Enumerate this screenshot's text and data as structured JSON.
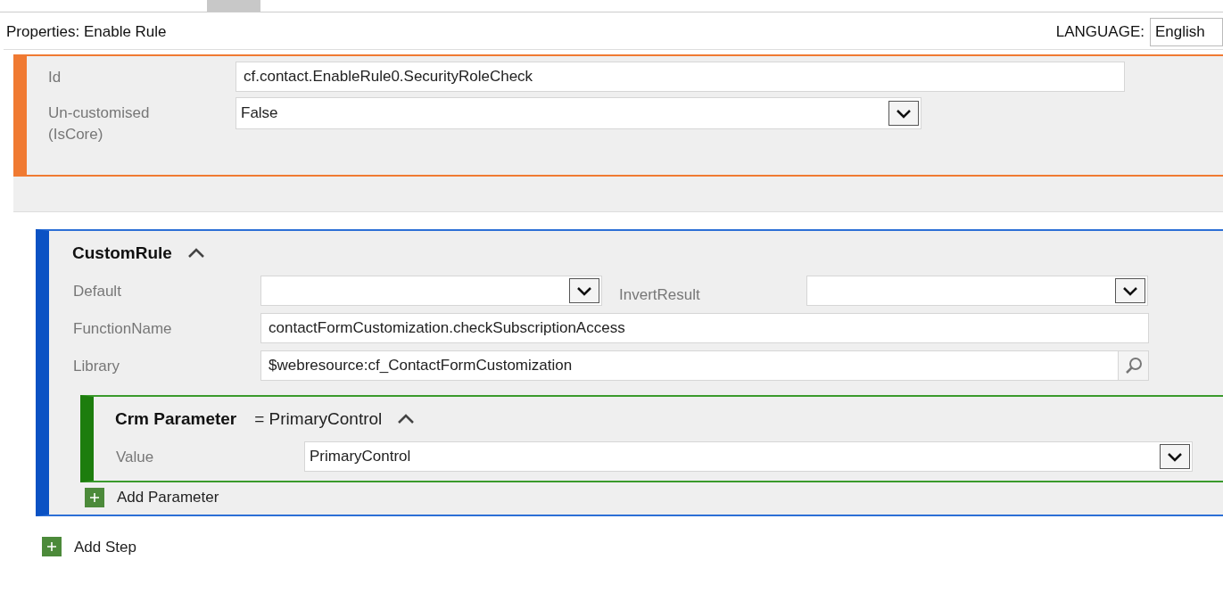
{
  "header": {
    "title": "Properties: Enable Rule",
    "language_label": "LANGUAGE:",
    "language_value": "English"
  },
  "general": {
    "fields": [
      {
        "kind": "text",
        "label": "Id",
        "value": "cf.contact.EnableRule0.SecurityRoleCheck"
      },
      {
        "kind": "select",
        "label": "Un-customised (IsCore)",
        "value": "False"
      }
    ]
  },
  "custom_rule": {
    "title": "CustomRule",
    "expanded": true,
    "rows": [
      [
        {
          "kind": "select",
          "label": "Default"
        },
        {
          "kind": "select",
          "label": "InvertResult"
        }
      ],
      [
        {
          "kind": "text",
          "label": "FunctionName",
          "value": "contactFormCustomization.checkSubscriptionAccess"
        }
      ],
      [
        {
          "kind": "lookup",
          "label": "Library",
          "value": "$webresource:cf_ContactFormCustomization"
        }
      ]
    ]
  },
  "crm_parameter": {
    "title": "Crm Parameter",
    "summary": "= PrimaryControl",
    "expanded": true,
    "fields": [
      {
        "kind": "select",
        "label": "Value",
        "value": "PrimaryControl"
      }
    ]
  },
  "add_parameter": "Add Parameter",
  "add_step": "Add Step"
}
